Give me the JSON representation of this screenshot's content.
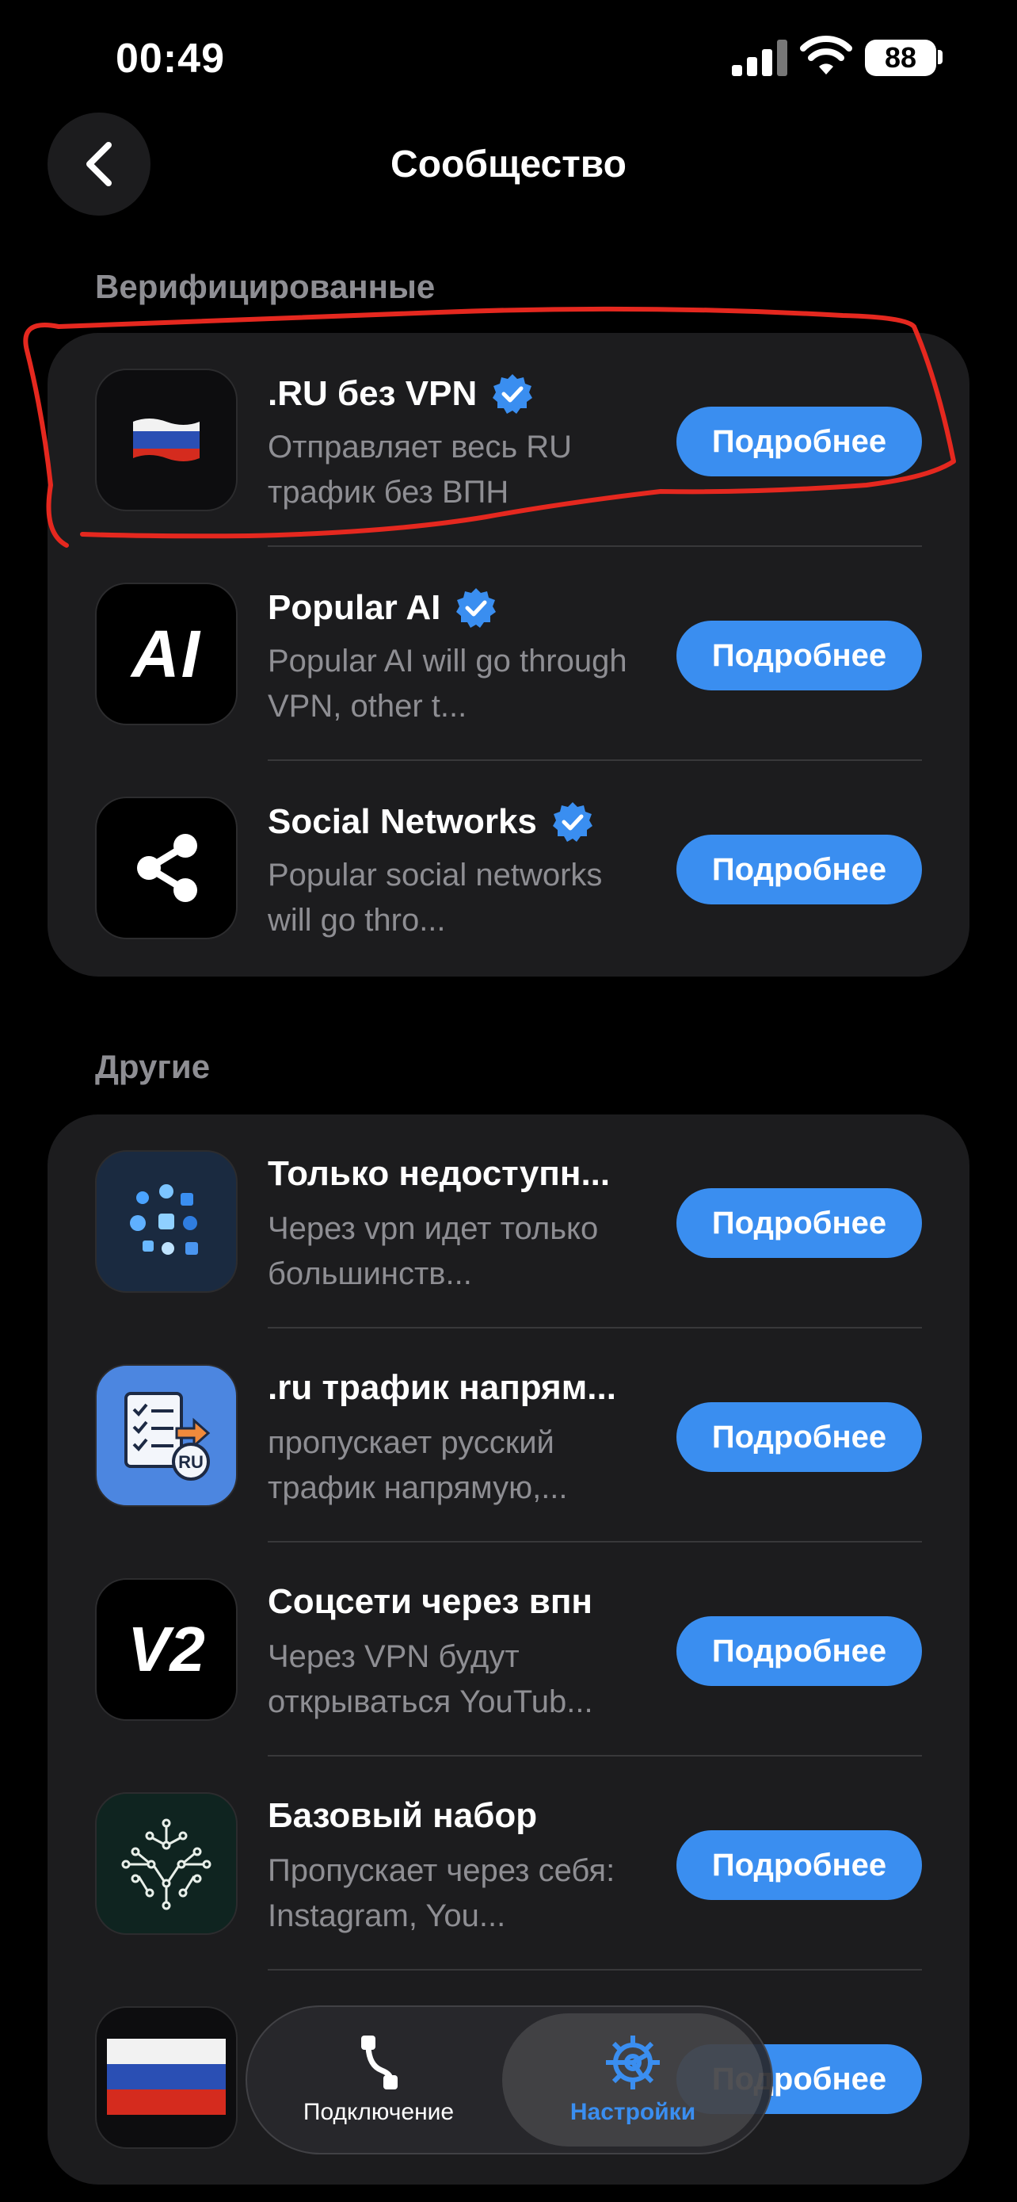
{
  "status_bar": {
    "time": "00:49",
    "battery": "88"
  },
  "header": {
    "title": "Сообщество"
  },
  "sections": {
    "verified": {
      "label": "Верифицированные",
      "items": [
        {
          "title": ".RU без VPN",
          "description": "Отправляет весь RU трафик без ВПН",
          "button": "Подробнее",
          "icon": "russia-flag-icon"
        },
        {
          "title": "Popular AI",
          "description": "Popular AI will go through VPN, other t...",
          "button": "Подробнее",
          "icon": "ai-text-icon"
        },
        {
          "title": "Social Networks",
          "description": "Popular social networks will go thro...",
          "button": "Подробнее",
          "icon": "share-icon"
        }
      ]
    },
    "other": {
      "label": "Другие",
      "items": [
        {
          "title": "Только недоступн...",
          "description": "Через vpn идет только большинств...",
          "button": "Подробнее",
          "icon": "apps-collage-icon"
        },
        {
          "title": ".ru трафик напрям...",
          "description": "пропускает русский трафик напрямую,...",
          "button": "Подробнее",
          "icon": "checklist-ru-icon"
        },
        {
          "title": "Соцсети через впн",
          "description": "Через VPN будут открываться YouTub...",
          "button": "Подробнее",
          "icon": "v2-text-icon"
        },
        {
          "title": "Базовый набор",
          "description": "Пропускает через себя: Instagram, You...",
          "button": "Подробнее",
          "icon": "circuit-pattern-icon"
        },
        {
          "title": "",
          "description": "",
          "button": "Подробнее",
          "icon": "russia-flag-icon"
        }
      ]
    }
  },
  "tab_bar": {
    "tabs": [
      {
        "label": "Подключение",
        "icon": "route-icon",
        "active": false
      },
      {
        "label": "Настройки",
        "icon": "gear-icon",
        "active": true
      }
    ]
  },
  "colors": {
    "accent": "#3a8ef0",
    "card_bg": "#1c1c1e",
    "secondary_text": "#8e8e93",
    "highlight_stroke": "#e5281f"
  },
  "thumb_text": {
    "ai": "AI",
    "v2": "V2",
    "ru": "RU"
  }
}
